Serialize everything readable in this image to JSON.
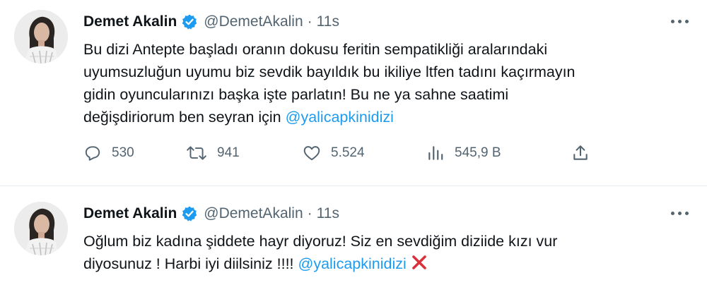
{
  "colors": {
    "link": "#1d9bf0",
    "muted": "#536471",
    "text": "#0f1419",
    "verified": "#1d9bf0",
    "xmark": "#d9323a"
  },
  "tweets": [
    {
      "author": {
        "name": "Demet Akalin",
        "handle": "@DemetAkalin",
        "separator": "·",
        "time": "11s",
        "verified_icon": "verified-badge-icon"
      },
      "text_lines": [
        "Bu dizi Antepte başladı oranın dokusu feritin sempatikliği aralarındaki",
        "uyumsuzluğun uyumu biz sevdik bayıldık bu ikiliye ltfen tadını kaçırmayın",
        "gidin oyuncularınızı başka işte parlatın! Bu ne ya sahne saatimi",
        "değişdiriorum ben seyran için "
      ],
      "mention": "@yalicapkinidizi",
      "stats": {
        "replies": "530",
        "retweets": "941",
        "likes": "5.524",
        "views": "545,9 B"
      }
    },
    {
      "author": {
        "name": "Demet Akalin",
        "handle": "@DemetAkalin",
        "separator": "·",
        "time": "11s",
        "verified_icon": "verified-badge-icon"
      },
      "text_lines": [
        "Oğlum biz kadına şiddete hayr diyoruz! Siz en sevdiğim diziide kızı vur",
        "diyosunuz ! Harbi iyi diilsiniz !!!! "
      ],
      "mention": "@yalicapkinidizi",
      "trailing_icon": "cross-mark-icon"
    }
  ]
}
